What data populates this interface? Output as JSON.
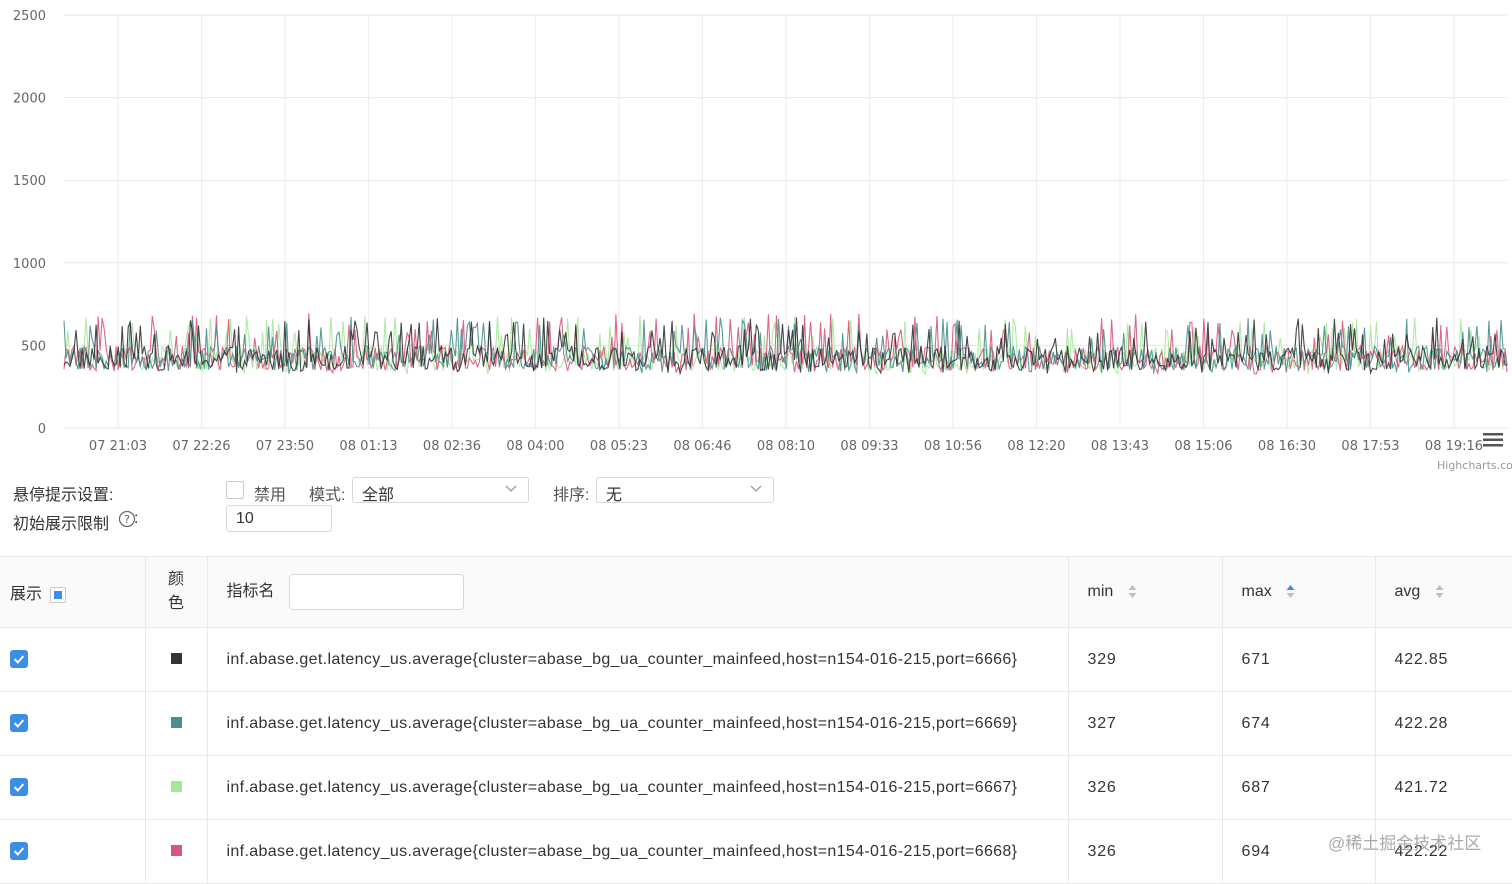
{
  "chart_data": {
    "type": "line",
    "y_ticks": [
      "0",
      "500",
      "1000",
      "1500",
      "2000",
      "2500"
    ],
    "ylim": [
      0,
      2500
    ],
    "x_ticks": [
      "07 21:03",
      "07 22:26",
      "07 23:50",
      "08 01:13",
      "08 02:36",
      "08 04:00",
      "08 05:23",
      "08 06:46",
      "08 08:10",
      "08 09:33",
      "08 10:56",
      "08 12:20",
      "08 13:43",
      "08 15:06",
      "08 16:30",
      "08 17:53",
      "08 19:16"
    ],
    "grid": true,
    "credits": "Highcharts.com",
    "series": [
      {
        "color": "#333333",
        "min": 329,
        "max": 671,
        "avg": 422.85
      },
      {
        "color": "#4a8f8c",
        "min": 327,
        "max": 674,
        "avg": 422.28
      },
      {
        "color": "#a6e89a",
        "min": 326,
        "max": 687,
        "avg": 421.72
      },
      {
        "color": "#d9577a",
        "min": 326,
        "max": 694,
        "avg": 422.22
      }
    ]
  },
  "settings": {
    "hover_label": "悬停提示设置:",
    "disable_label": "禁用",
    "mode_label": "模式:",
    "mode_value": "全部",
    "sort_label": "排序:",
    "sort_value": "无",
    "init_limit_label": "初始展示限制",
    "init_limit_value": "10"
  },
  "table": {
    "headers": {
      "show": "展示",
      "color_line1": "颜",
      "color_line2": "色",
      "metric": "指标名",
      "min": "min",
      "max": "max",
      "avg": "avg"
    },
    "rows": [
      {
        "color": "#333333",
        "name": "inf.abase.get.latency_us.average{cluster=abase_bg_ua_counter_mainfeed,host=n154-016-215,port=6666}",
        "min": "329",
        "max": "671",
        "avg": "422.85"
      },
      {
        "color": "#4a8f8c",
        "name": "inf.abase.get.latency_us.average{cluster=abase_bg_ua_counter_mainfeed,host=n154-016-215,port=6669}",
        "min": "327",
        "max": "674",
        "avg": "422.28"
      },
      {
        "color": "#a6e89a",
        "name": "inf.abase.get.latency_us.average{cluster=abase_bg_ua_counter_mainfeed,host=n154-016-215,port=6667}",
        "min": "326",
        "max": "687",
        "avg": "421.72"
      },
      {
        "color": "#d9577a",
        "name": "inf.abase.get.latency_us.average{cluster=abase_bg_ua_counter_mainfeed,host=n154-016-215,port=6668}",
        "min": "326",
        "max": "694",
        "avg": "422.22"
      }
    ]
  },
  "watermark": "@稀土掘金技术社区",
  "icons": {
    "menu": "hamburger-menu-icon",
    "help": "question-circle-icon",
    "dropdown": "chevron-down-icon",
    "sort": "sort-caret-icon",
    "check": "check-icon"
  }
}
